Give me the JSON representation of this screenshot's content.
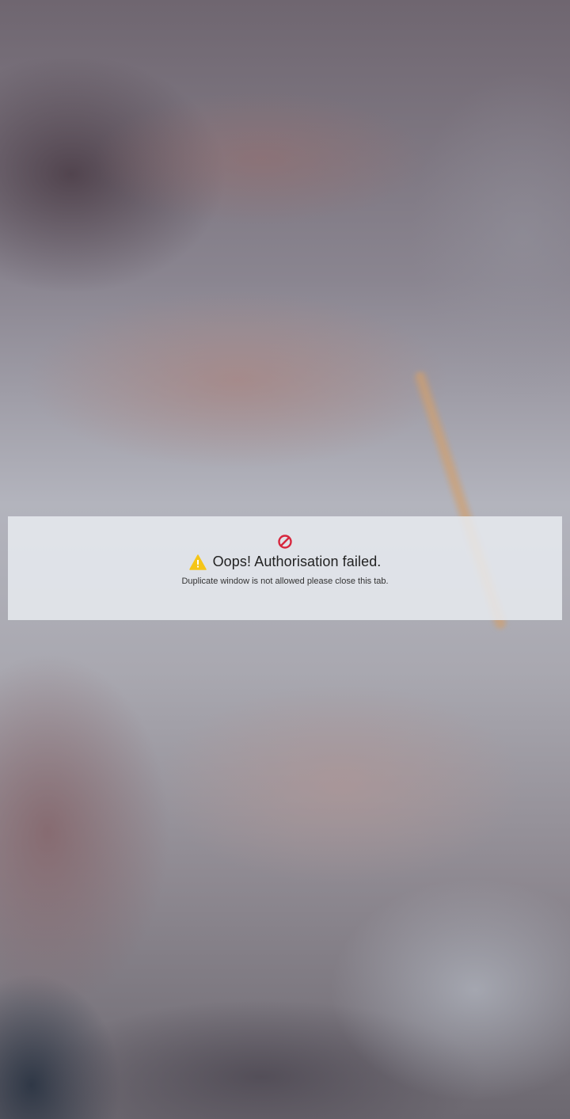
{
  "error": {
    "title": "Oops! Authorisation failed.",
    "message": "Duplicate window is not allowed please close this tab.",
    "block_icon": "no-entry-icon",
    "warning_icon": "warning-icon",
    "block_icon_color": "#d7263d",
    "warning_icon_color": "#f5c518"
  }
}
